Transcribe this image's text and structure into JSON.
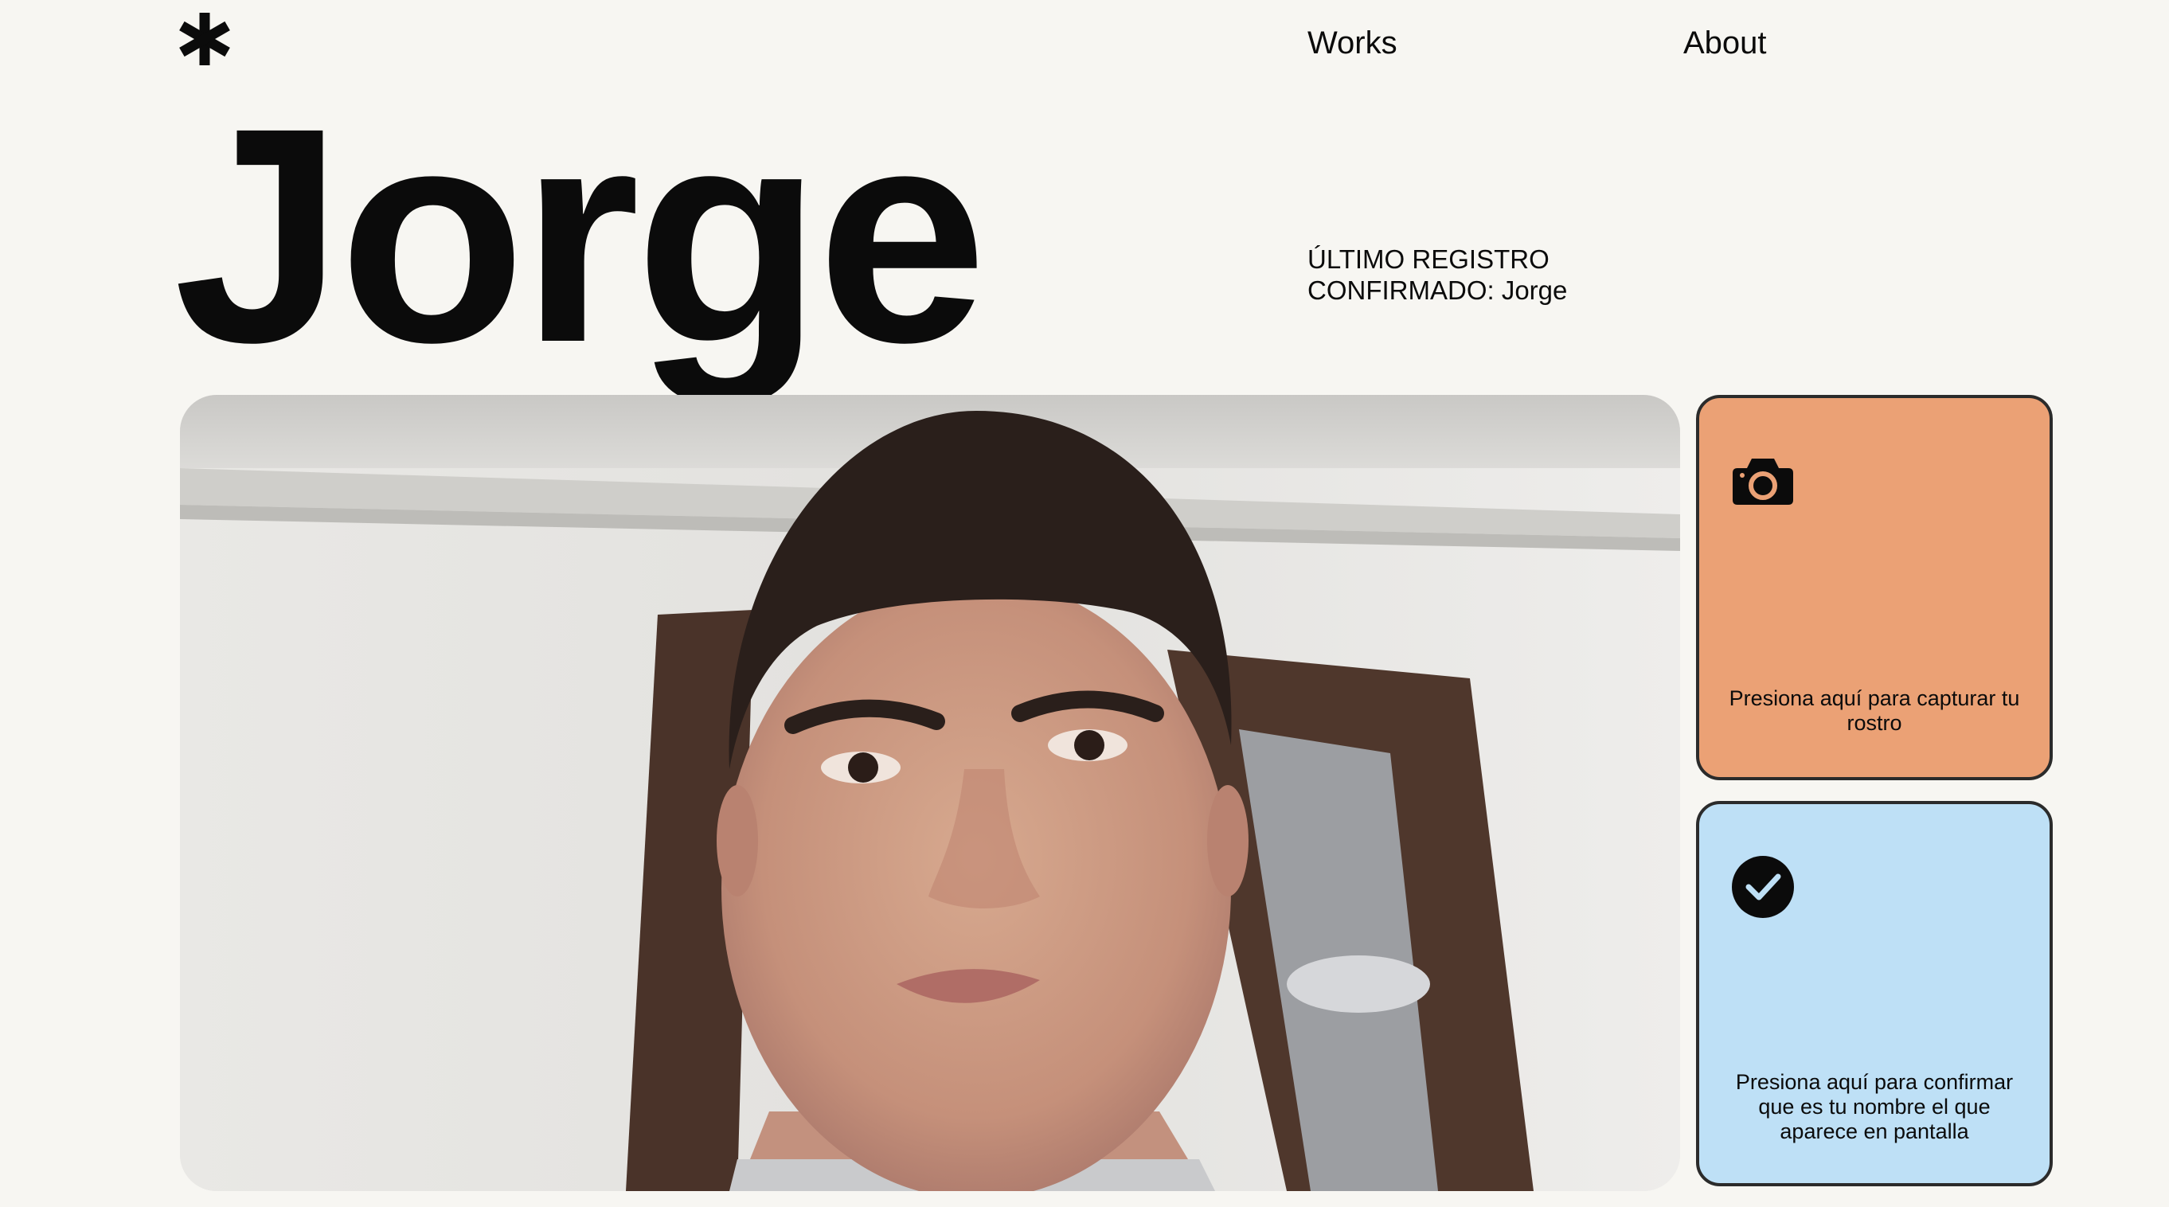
{
  "header": {
    "logo_icon": "asterisk-icon",
    "nav": {
      "works": "Works",
      "about": "About"
    }
  },
  "hero": {
    "name": "Jorge",
    "status_line1": "ÚLTIMO REGISTRO",
    "status_line2": "CONFIRMADO: Jorge"
  },
  "camera": {
    "feed": "live-camera-feed"
  },
  "actions": {
    "capture": {
      "icon": "camera-icon",
      "label": "Presiona aquí para capturar tu rostro",
      "color": "#eba175"
    },
    "confirm": {
      "icon": "check-circle-icon",
      "label": "Presiona aquí para confirmar que es tu nombre el que aparece en pantalla",
      "color": "#bee0f6"
    }
  }
}
